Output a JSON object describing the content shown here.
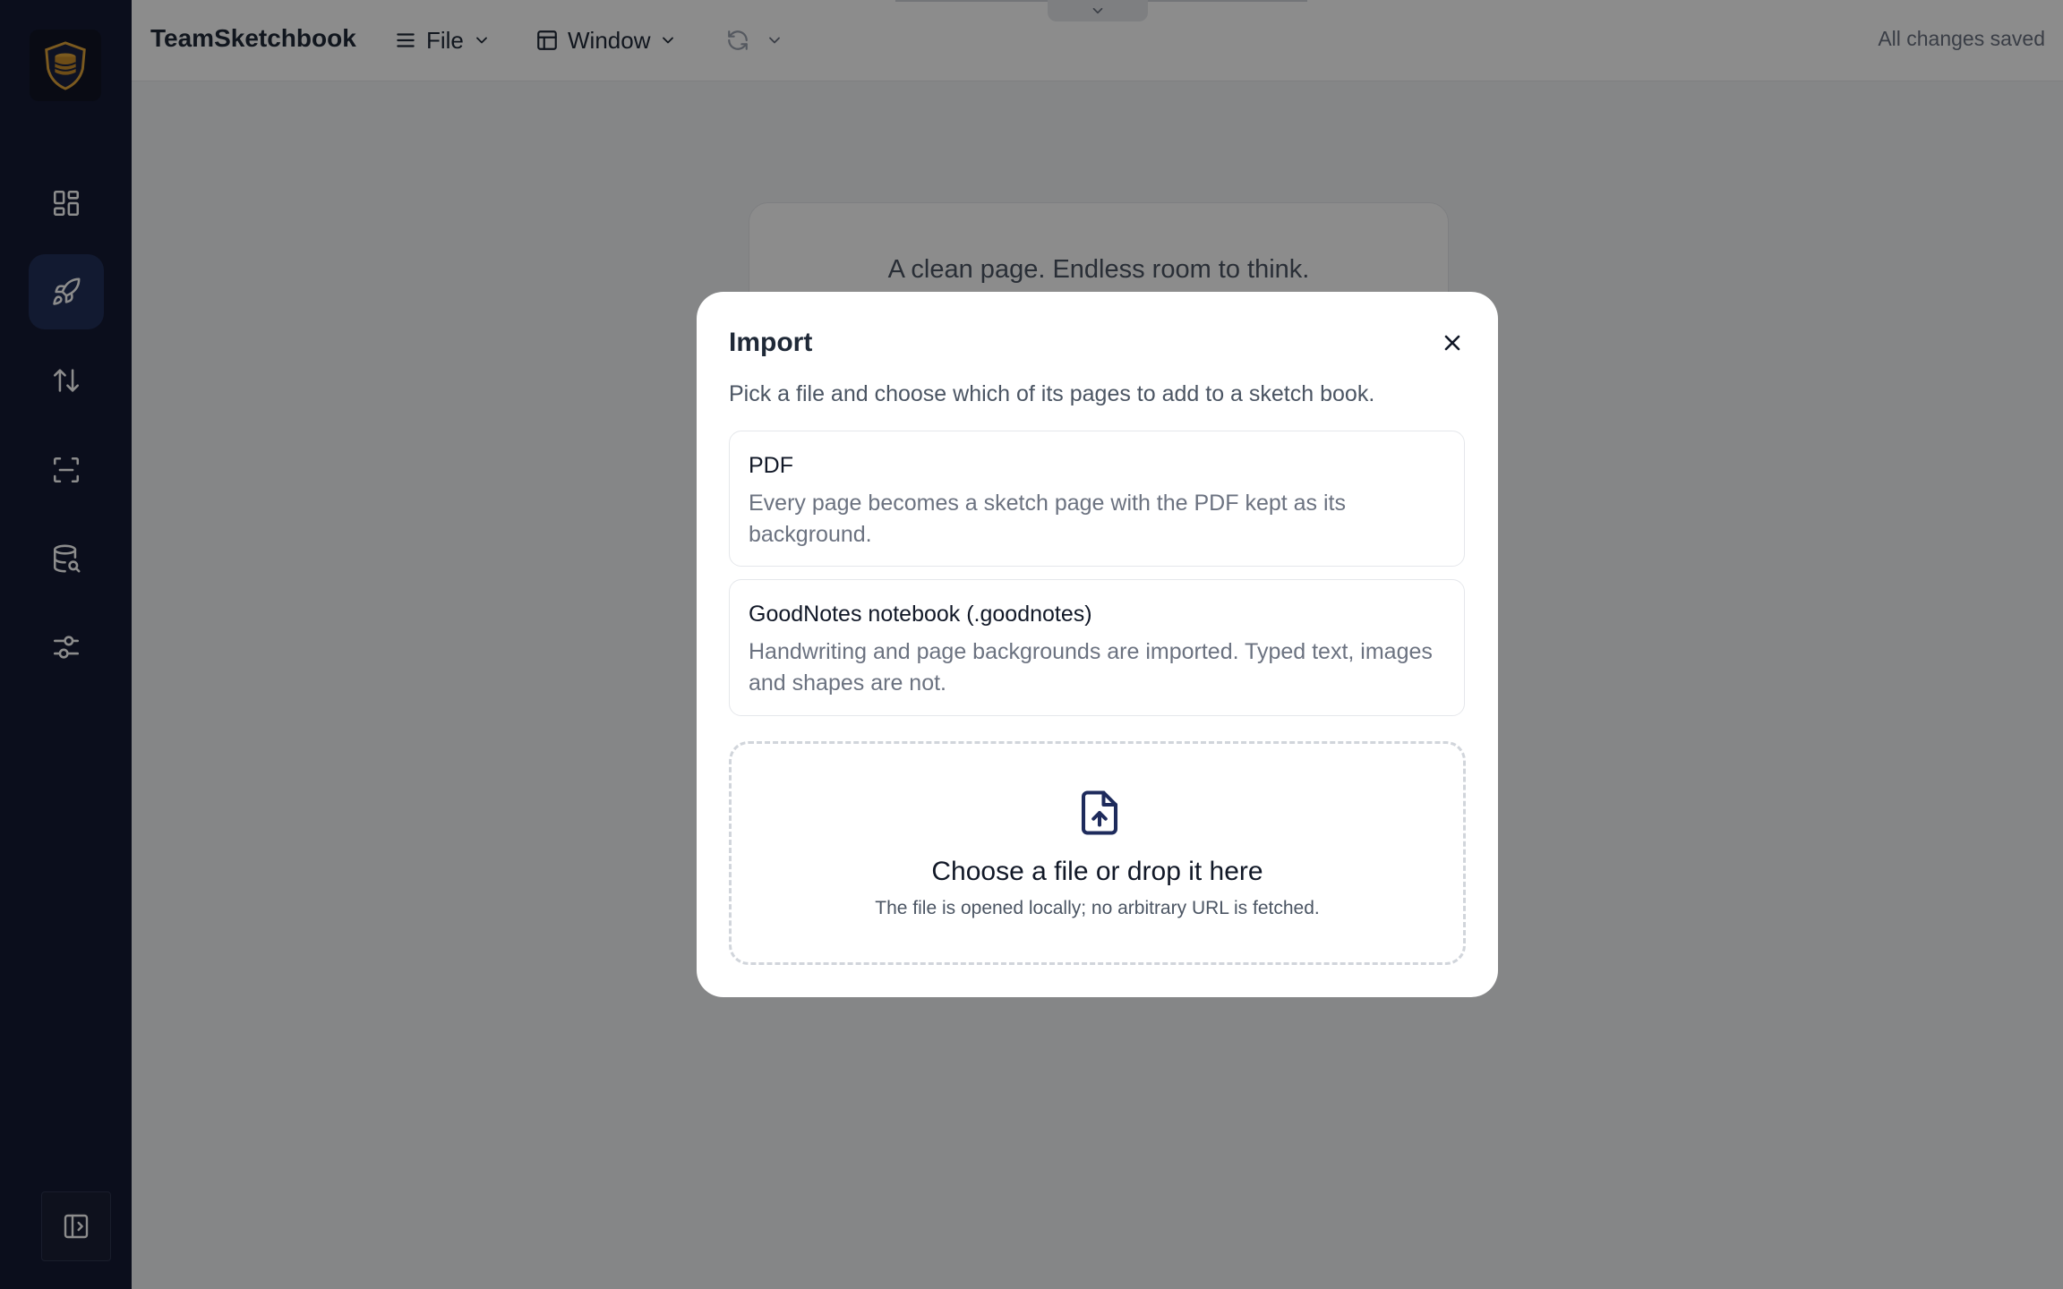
{
  "app": {
    "title": "TeamSketchbook",
    "status": "All changes saved"
  },
  "menus": {
    "file_label": "File",
    "window_label": "Window"
  },
  "sidebar": {
    "items": [
      {
        "name": "dashboard",
        "icon": "grid-icon"
      },
      {
        "name": "launch",
        "icon": "rocket-icon",
        "active": true
      },
      {
        "name": "sort",
        "icon": "sort-arrows-icon"
      },
      {
        "name": "scan",
        "icon": "scan-icon"
      },
      {
        "name": "database-search",
        "icon": "database-search-icon"
      },
      {
        "name": "settings",
        "icon": "sliders-icon"
      }
    ],
    "collapse_icon": "sidebar-expand-icon"
  },
  "canvas": {
    "card_text": "A clean page. Endless room to think."
  },
  "modal": {
    "title": "Import",
    "description": "Pick a file and choose which of its pages to add to a sketch book.",
    "options": [
      {
        "title": "PDF",
        "description": "Every page becomes a sketch page with the PDF kept as its background."
      },
      {
        "title": "GoodNotes notebook (.goodnotes)",
        "description": "Handwriting and page backgrounds are imported. Typed text, images and shapes are not."
      }
    ],
    "dropzone": {
      "title": "Choose a file or drop it here",
      "subtitle": "The file is opened locally; no arbitrary URL is fetched."
    }
  },
  "colors": {
    "sidebar_bg": "#141a33",
    "active_item_bg": "#22305a",
    "accent_icon": "#1e2b5c"
  }
}
